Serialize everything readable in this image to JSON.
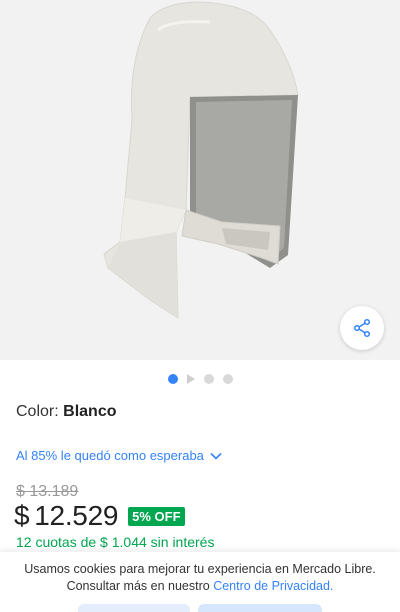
{
  "product": {
    "color_label": "Color:",
    "color_value": "Blanco",
    "satisfaction_text": "Al 85% le quedó como esperaba",
    "original_price": "$ 13.189",
    "currency_symbol": "$",
    "price": "12.529",
    "discount": "5% OFF",
    "installments": "12 cuotas de $ 1.044 sin interés"
  },
  "gallery": {
    "current_index": 1,
    "dots": [
      "image",
      "video",
      "image",
      "image"
    ]
  },
  "cookie_banner": {
    "line1": "Usamos cookies para mejorar tu experiencia en Mercado Libre.",
    "line2_prefix": "Consultar más en nuestro",
    "privacy_link": "Centro de Privacidad."
  },
  "colors": {
    "accent_blue": "#3483fa",
    "discount_green": "#00a650"
  }
}
